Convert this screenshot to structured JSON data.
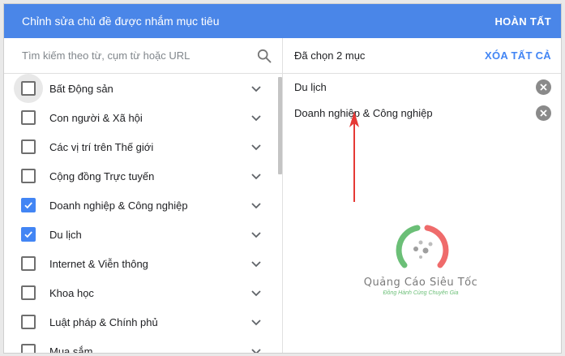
{
  "header": {
    "title": "Chỉnh sửa chủ đề được nhắm mục tiêu",
    "done_label": "HOÀN TẤT"
  },
  "search": {
    "placeholder": "Tìm kiếm theo từ, cụm từ hoặc URL",
    "icon": "search-icon"
  },
  "categories": [
    {
      "label": "Bất Động sản",
      "checked": false
    },
    {
      "label": "Con người & Xã hội",
      "checked": false
    },
    {
      "label": "Các vị trí trên Thế giới",
      "checked": false
    },
    {
      "label": "Cộng đồng Trực tuyến",
      "checked": false
    },
    {
      "label": "Doanh nghiệp & Công nghiệp",
      "checked": true
    },
    {
      "label": "Du lịch",
      "checked": true
    },
    {
      "label": "Internet & Viễn thông",
      "checked": false
    },
    {
      "label": "Khoa học",
      "checked": false
    },
    {
      "label": "Luật pháp & Chính phủ",
      "checked": false
    },
    {
      "label": "Mua sắm",
      "checked": false
    }
  ],
  "selection": {
    "count_label": "Đã chọn 2 mục",
    "clear_all_label": "XÓA TẤT CẢ",
    "items": [
      {
        "label": "Du lịch"
      },
      {
        "label": "Doanh nghiệp & Công nghiệp"
      }
    ]
  },
  "watermark": {
    "brand": "Quảng Cáo Siêu Tốc",
    "tagline": "Đồng Hành Cùng Chuyên Gia"
  },
  "colors": {
    "header_bg": "#4a86e8",
    "accent": "#4285f4",
    "arrow": "#e53935"
  }
}
